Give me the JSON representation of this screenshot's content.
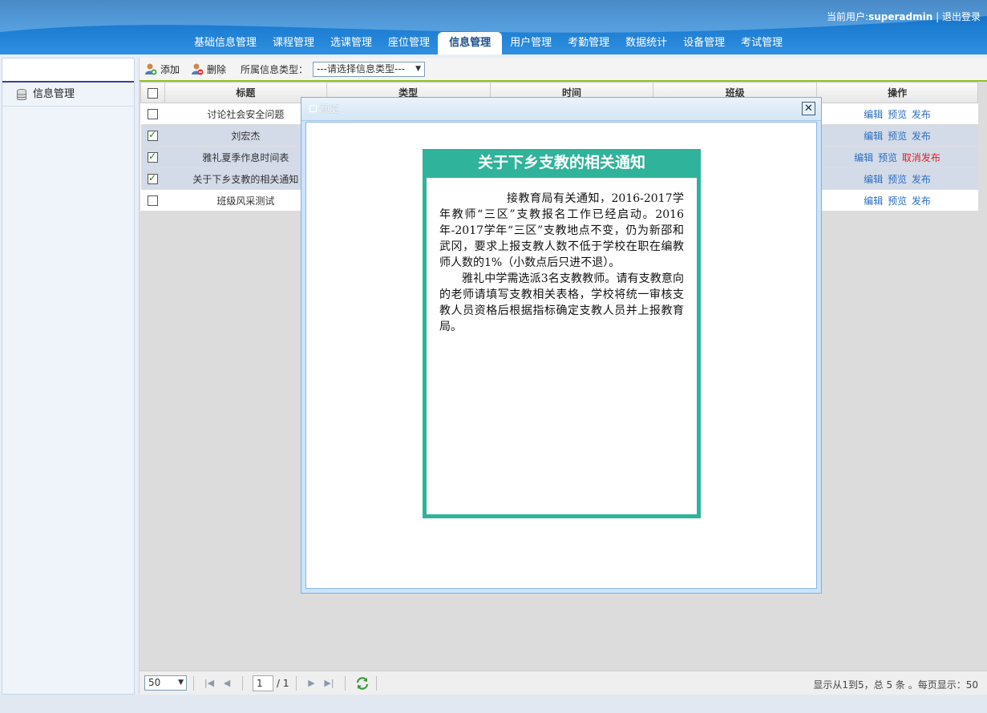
{
  "header": {
    "user_label": "当前用户:",
    "username": "superadmin",
    "separator": "|",
    "logout": "退出登录",
    "nav": [
      "基础信息管理",
      "课程管理",
      "选课管理",
      "座位管理",
      "信息管理",
      "用户管理",
      "考勤管理",
      "数据统计",
      "设备管理",
      "考试管理"
    ],
    "active_nav": "信息管理"
  },
  "sidebar": {
    "items": [
      {
        "label": "信息管理",
        "icon": "database-icon"
      }
    ]
  },
  "toolbar": {
    "add_label": "添加",
    "delete_label": "删除",
    "type_label": "所属信息类型：",
    "type_select_value": "---请选择信息类型---"
  },
  "grid": {
    "columns": [
      "标题",
      "类型",
      "时间",
      "班级",
      "操作"
    ],
    "rows": [
      {
        "title": "讨论社会安全问题",
        "checked": false,
        "ops": [
          "编辑",
          "预览",
          "发布"
        ],
        "publish_red": false
      },
      {
        "title": "刘宏杰",
        "checked": true,
        "ops": [
          "编辑",
          "预览",
          "发布"
        ],
        "publish_red": false
      },
      {
        "title": "雅礼夏季作息时间表",
        "checked": true,
        "ops": [
          "编辑",
          "预览",
          "取消发布"
        ],
        "publish_red": true
      },
      {
        "title": "关于下乡支教的相关通知",
        "checked": true,
        "ops": [
          "编辑",
          "预览",
          "发布"
        ],
        "publish_red": false
      },
      {
        "title": "班级风采测试",
        "checked": false,
        "ops": [
          "编辑",
          "预览",
          "发布"
        ],
        "publish_red": false
      }
    ]
  },
  "pager": {
    "page_size": "50",
    "current_page": "1",
    "total_pages": "/ 1",
    "info": "显示从1到5，总 5 条 。每页显示：50"
  },
  "modal": {
    "title": "预览",
    "close": "✕",
    "notice": {
      "title": "关于下乡支教的相关通知",
      "paragraph1": "接教育局有关通知，2016-2017学年教师“三区”支教报名工作已经启动。2016年-2017学年“三区”支教地点不变，仍为新邵和武冈，要求上报支教人数不低于学校在职在编教师人数的1%（小数点后只进不退）。",
      "paragraph2": "雅礼中学需选派3名支教教师。请有支教意向的老师请填写支教相关表格，学校将统一审核支教人员资格后根据指标确定支教人员并上报教育局。"
    }
  },
  "colors": {
    "header_blue": "#1a7bd0",
    "notice_green": "#2fb39a",
    "link_blue": "#2a6fbf",
    "cancel_red": "#e02020",
    "toolbar_line": "#8fc31f"
  }
}
